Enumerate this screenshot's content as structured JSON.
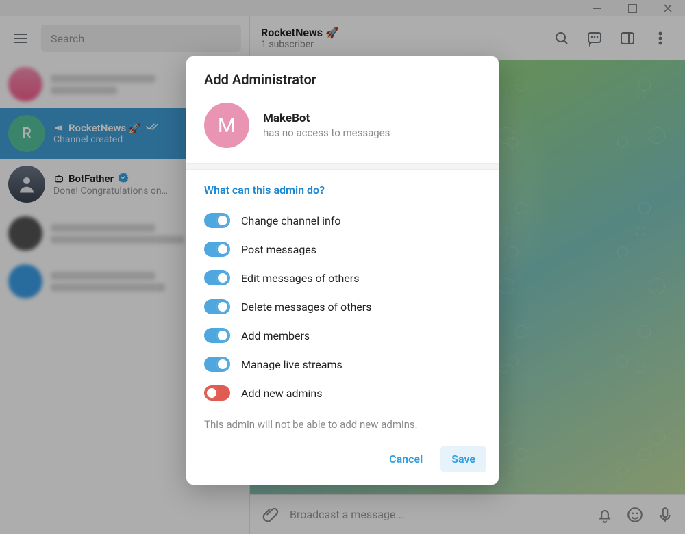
{
  "titlebar": {
    "min": "minimize",
    "max": "maximize",
    "close": "close"
  },
  "sidebar": {
    "search_placeholder": "Search",
    "chats": [
      {
        "title": "",
        "sub": ""
      },
      {
        "title": "RocketNews 🚀",
        "sub": "Channel created",
        "type": "channel",
        "avatar_letter": "R"
      },
      {
        "title": "BotFather",
        "sub": "Done! Congratulations on…",
        "verified": true
      }
    ]
  },
  "header": {
    "title": "RocketNews 🚀",
    "subscribers": "1 subscriber"
  },
  "bg_pill": "ed",
  "composer": {
    "placeholder": "Broadcast a message..."
  },
  "modal": {
    "title": "Add Administrator",
    "user": {
      "avatar_letter": "M",
      "name": "MakeBot",
      "sub": "has no access to messages"
    },
    "section_title": "What can this admin do?",
    "permissions": [
      {
        "label": "Change channel info",
        "on": true
      },
      {
        "label": "Post messages",
        "on": true
      },
      {
        "label": "Edit messages of others",
        "on": true
      },
      {
        "label": "Delete messages of others",
        "on": true
      },
      {
        "label": "Add members",
        "on": true
      },
      {
        "label": "Manage live streams",
        "on": true
      },
      {
        "label": "Add new admins",
        "on": false
      }
    ],
    "note": "This admin will not be able to add new admins.",
    "cancel": "Cancel",
    "save": "Save"
  }
}
